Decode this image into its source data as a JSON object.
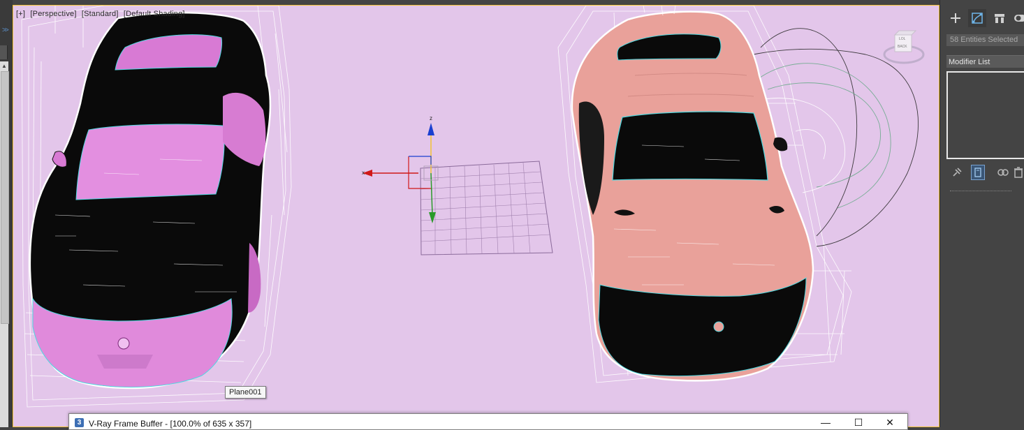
{
  "viewport": {
    "label_parts": [
      "[+]",
      "[Perspective]",
      "[Standard]",
      "[Default Shading]"
    ],
    "tooltip": "Plane001",
    "gizmo_axes": {
      "z": "z",
      "x": "x"
    },
    "viewcube": {
      "top": "LOL",
      "back": "BACK"
    },
    "background_color": "#e3c6ea",
    "active_border_color": "#f1c232"
  },
  "command_panel": {
    "tabs": [
      {
        "icon": "plus-icon",
        "active": false
      },
      {
        "icon": "modify-icon",
        "active": true
      },
      {
        "icon": "hierarchy-icon",
        "active": false
      },
      {
        "icon": "motion-icon",
        "active": false
      }
    ],
    "selection_text": "58 Entities Selected",
    "modifier_list_label": "Modifier List",
    "stack_tools": [
      "pin-stack-icon",
      "show-end-result-icon",
      "make-unique-icon",
      "remove-modifier-icon"
    ]
  },
  "left_strip": {
    "chevron": ">>"
  },
  "vfb_window": {
    "icon_text": "3",
    "title": "V-Ray Frame Buffer - [100.0% of 635 x 357]",
    "minimize": "—",
    "maximize": "☐",
    "close": "✕"
  }
}
